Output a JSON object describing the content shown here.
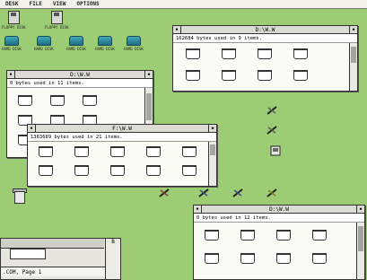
{
  "menubar": {
    "items": [
      "DESK",
      "FILE",
      "VIEW",
      "OPTIONS"
    ]
  },
  "desk_icons": [
    {
      "kind": "floppy",
      "label": "FLOPPY DISK"
    },
    {
      "kind": "floppy",
      "label": "FLOPPY DISK"
    },
    {
      "kind": "drive",
      "label": "HARD DISK"
    },
    {
      "kind": "drive",
      "label": "HARD DISK"
    },
    {
      "kind": "drive",
      "label": "HARD DISK"
    },
    {
      "kind": "drive",
      "label": "HARD DISK"
    },
    {
      "kind": "drive",
      "label": "HARD DISK"
    }
  ],
  "windows": [
    {
      "title": "D:\\W.W",
      "info": "162684 bytes used in 9 items."
    },
    {
      "title": "D:\\W.W",
      "info": "0 bytes used in 11 items."
    },
    {
      "title": "F:\\W.W",
      "info": "1363689 bytes used in 21 items."
    },
    {
      "title": "D:\\W.W",
      "info": "0 bytes used in 12 items."
    }
  ],
  "editor": {
    "status": ".COM, Page 1",
    "side_label": "B"
  },
  "window_controls": {
    "close": "B",
    "size": "B"
  }
}
